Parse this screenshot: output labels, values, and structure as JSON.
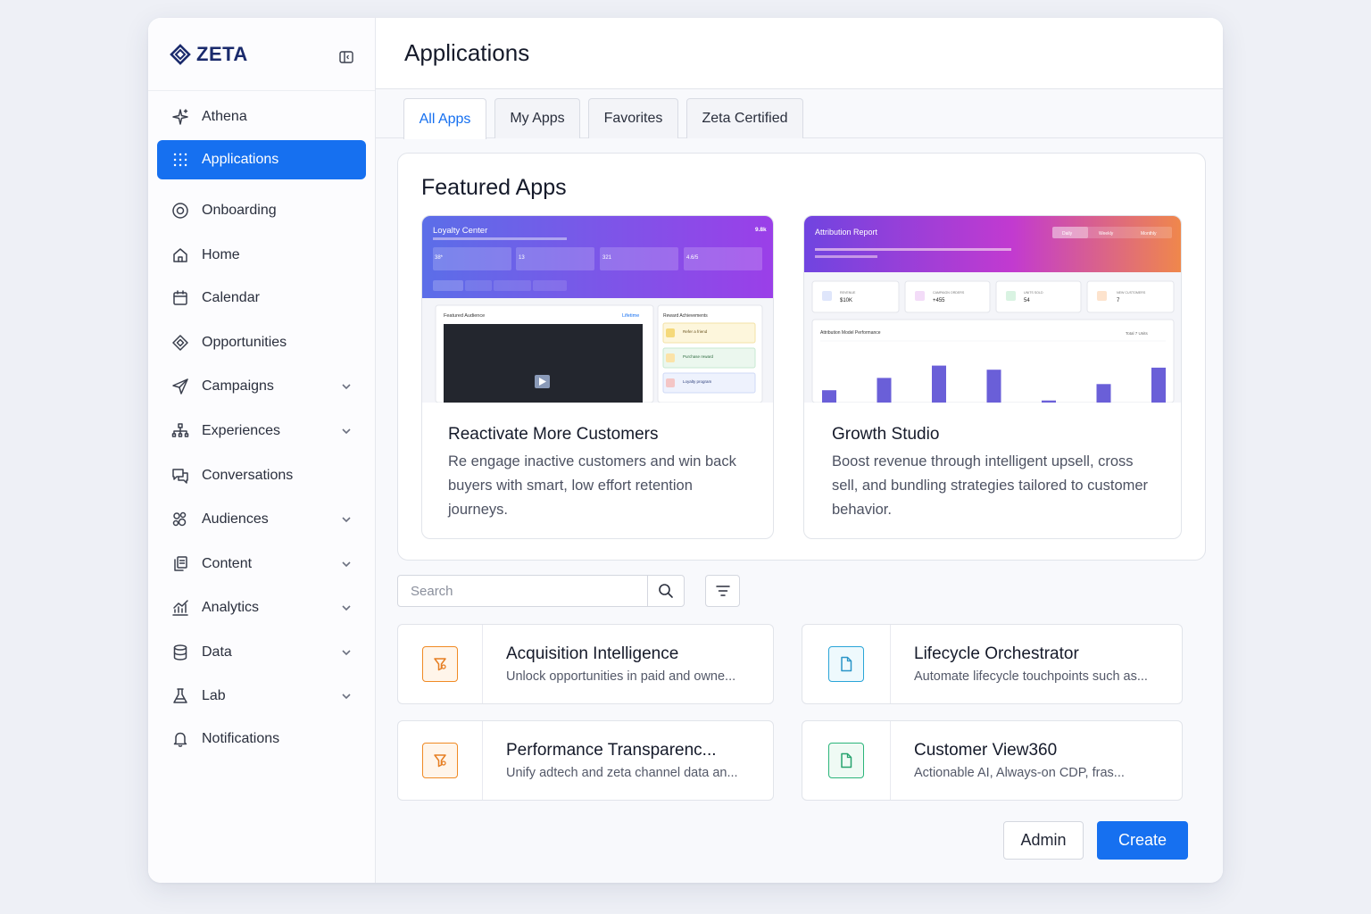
{
  "brand": {
    "name": "ZETA"
  },
  "page": {
    "title": "Applications"
  },
  "sidebar": {
    "items": [
      {
        "label": "Athena",
        "icon": "sparkle-icon",
        "active": false,
        "expandable": false
      },
      {
        "label": "Applications",
        "icon": "grid-icon",
        "active": true,
        "expandable": false
      },
      {
        "label": "Onboarding",
        "icon": "target-icon",
        "active": false,
        "expandable": false
      },
      {
        "label": "Home",
        "icon": "home-icon",
        "active": false,
        "expandable": false
      },
      {
        "label": "Calendar",
        "icon": "calendar-icon",
        "active": false,
        "expandable": false
      },
      {
        "label": "Opportunities",
        "icon": "diamond-icon",
        "active": false,
        "expandable": false
      },
      {
        "label": "Campaigns",
        "icon": "send-icon",
        "active": false,
        "expandable": true
      },
      {
        "label": "Experiences",
        "icon": "hierarchy-icon",
        "active": false,
        "expandable": true
      },
      {
        "label": "Conversations",
        "icon": "chat-icon",
        "active": false,
        "expandable": false
      },
      {
        "label": "Audiences",
        "icon": "audience-icon",
        "active": false,
        "expandable": true
      },
      {
        "label": "Content",
        "icon": "content-icon",
        "active": false,
        "expandable": true
      },
      {
        "label": "Analytics",
        "icon": "analytics-icon",
        "active": false,
        "expandable": true
      },
      {
        "label": "Data",
        "icon": "database-icon",
        "active": false,
        "expandable": true
      },
      {
        "label": "Lab",
        "icon": "flask-icon",
        "active": false,
        "expandable": true
      },
      {
        "label": "Notifications",
        "icon": "bell-icon",
        "active": false,
        "expandable": false
      }
    ]
  },
  "tabs": [
    {
      "label": "All Apps",
      "active": true
    },
    {
      "label": "My Apps",
      "active": false
    },
    {
      "label": "Favorites",
      "active": false
    },
    {
      "label": "Zeta Certified",
      "active": false
    }
  ],
  "featured": {
    "title": "Featured Apps",
    "cards": [
      {
        "title": "Reactivate More Customers",
        "description": "Re engage inactive customers and win back buyers with smart, low effort retention journeys.",
        "preview": {
          "title": "Loyalty Center",
          "right_label": "9.8k",
          "stats": [
            "38*",
            "13",
            "321",
            "4.6/5"
          ],
          "left_panel_title": "Featured Audience",
          "left_panel_link": "Lifetime",
          "right_panel_title": "Reward Achievements",
          "rewards": [
            "Refer a friend",
            "Purchase reward",
            "Loyalty program"
          ]
        }
      },
      {
        "title": "Growth Studio",
        "description": "Boost revenue through intelligent upsell, cross sell, and bundling strategies tailored to customer behavior.",
        "preview": {
          "title": "Attribution Report",
          "toggles": [
            "Daily",
            "Weekly",
            "Monthly"
          ],
          "kpis": [
            {
              "label": "REVENUE",
              "value": "$10K"
            },
            {
              "label": "CAMPAIGN ORDERS",
              "value": "+455"
            },
            {
              "label": "UNITS SOLD",
              "value": "54"
            },
            {
              "label": "NEW CUSTOMERS",
              "value": "7"
            }
          ],
          "chart_title": "Attribution Model Performance",
          "chart_note": "Total 7 Units",
          "bar_levels": [
            0.3,
            0.6,
            0.9,
            0.8,
            0.05,
            0.45,
            0.85
          ]
        }
      }
    ]
  },
  "search": {
    "placeholder": "Search"
  },
  "apps": [
    {
      "name": "Acquisition Intelligence",
      "description": "Unlock opportunities in paid and owne...",
      "icon": "funnel-icon",
      "color": "#f08a24"
    },
    {
      "name": "Lifecycle Orchestrator",
      "description": "Automate lifecycle touchpoints such as...",
      "icon": "document-icon",
      "color": "#2aa5d8"
    },
    {
      "name": "Performance Transparenc...",
      "description": "Unify adtech and zeta channel data an...",
      "icon": "funnel-icon",
      "color": "#f08a24"
    },
    {
      "name": "Customer View360",
      "description": "Actionable AI, Always-on CDP, fras...",
      "icon": "document-icon",
      "color": "#2bb57a"
    }
  ],
  "actions": {
    "admin": "Admin",
    "create": "Create"
  },
  "colors": {
    "accent": "#1670f0",
    "brand": "#1a2a6c"
  }
}
